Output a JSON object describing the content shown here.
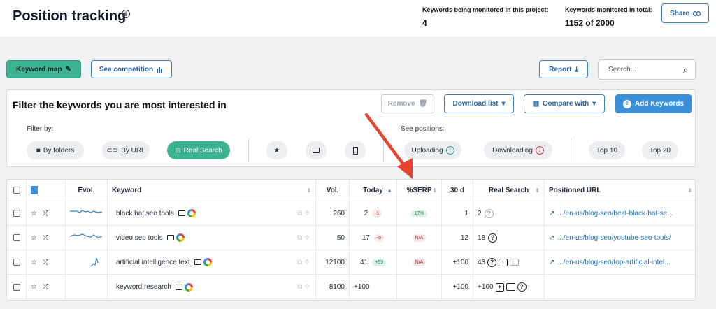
{
  "header": {
    "title": "Position tracking",
    "monitored_project_label": "Keywords being monitored in this project:",
    "monitored_project_value": "4",
    "monitored_total_label": "Keywords monitored in total:",
    "monitored_total_value": "1152 of 2000",
    "share_label": "Share"
  },
  "toolbar": {
    "keyword_map_label": "Keyword map",
    "see_competition_label": "See competition",
    "report_label": "Report",
    "search_placeholder": "Search..."
  },
  "filter": {
    "title": "Filter the keywords you are most interested in",
    "remove_label": "Remove",
    "download_list_label": "Download list",
    "compare_with_label": "Compare with",
    "add_keywords_label": "Add Keywords",
    "filter_by_label": "Filter by:",
    "by_folders_label": "By folders",
    "by_url_label": "By URL",
    "real_search_label": "Real Search",
    "see_positions_label": "See positions:",
    "uploading_label": "Uploading",
    "downloading_label": "Downloading",
    "top10_label": "Top 10",
    "top20_label": "Top 20"
  },
  "table": {
    "headers": {
      "evol": "Evol.",
      "keyword": "Keyword",
      "vol": "Vol.",
      "today": "Today",
      "serp": "%SERP",
      "d30": "30 d",
      "real_search": "Real Search",
      "url": "Positioned URL"
    },
    "rows": [
      {
        "keyword": "black hat seo tools",
        "vol": "260",
        "today": "2",
        "change": "-1",
        "serp": "17%",
        "d30": "1",
        "real": "2",
        "url": ".../en-us/blog-seo/best-black-hat-se..."
      },
      {
        "keyword": "video seo tools",
        "vol": "50",
        "today": "17",
        "change": "-5",
        "serp": "N/A",
        "d30": "12",
        "real": "18",
        "url": ".../en-us/blog-seo/youtube-seo-tools/"
      },
      {
        "keyword": "artificial intelligence text",
        "vol": "12100",
        "today": "41",
        "change": "+59",
        "serp": "N/A",
        "d30": "+100",
        "real": "43",
        "url": ".../en-us/blog-seo/top-artificial-intel..."
      },
      {
        "keyword": "keyword research",
        "vol": "8100",
        "today": "+100",
        "change": "",
        "serp": "",
        "d30": "+100",
        "real": "+100",
        "url": ""
      }
    ]
  },
  "colors": {
    "accent_green": "#3cb391",
    "accent_blue": "#3b8ed8",
    "arrow_red": "#e8452c",
    "link_blue": "#1e6fb8"
  }
}
